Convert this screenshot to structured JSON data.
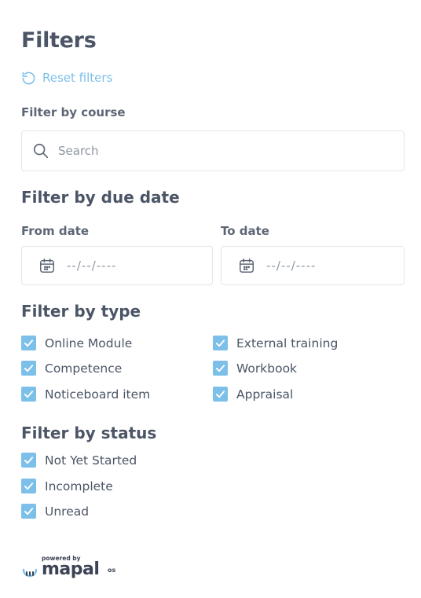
{
  "header": {
    "title": "Filters",
    "reset_label": "Reset filters"
  },
  "course": {
    "label": "Filter by course",
    "search_placeholder": "Search"
  },
  "due_date": {
    "title": "Filter by due date",
    "from_label": "From date",
    "to_label": "To date",
    "from_placeholder": "--/--/----",
    "to_placeholder": "--/--/----"
  },
  "type_filter": {
    "title": "Filter by type",
    "options": [
      {
        "label": "Online Module",
        "checked": true
      },
      {
        "label": "External training",
        "checked": true
      },
      {
        "label": "Competence",
        "checked": true
      },
      {
        "label": "Workbook",
        "checked": true
      },
      {
        "label": "Noticeboard item",
        "checked": true
      },
      {
        "label": "Appraisal",
        "checked": true
      }
    ]
  },
  "status_filter": {
    "title": "Filter by status",
    "options": [
      {
        "label": "Not Yet Started",
        "checked": true
      },
      {
        "label": "Incomplete",
        "checked": true
      },
      {
        "label": "Unread",
        "checked": true
      }
    ]
  },
  "footer": {
    "powered_by": "powered by",
    "brand": "mapal",
    "brand_suffix": "os"
  },
  "colors": {
    "accent": "#7cc0ea",
    "heading": "#4b5566",
    "border": "#e2e5ea"
  },
  "icons": {
    "reset": "rotate-ccw-icon",
    "search": "search-icon",
    "calendar": "calendar-icon",
    "check": "checkmark-icon"
  }
}
